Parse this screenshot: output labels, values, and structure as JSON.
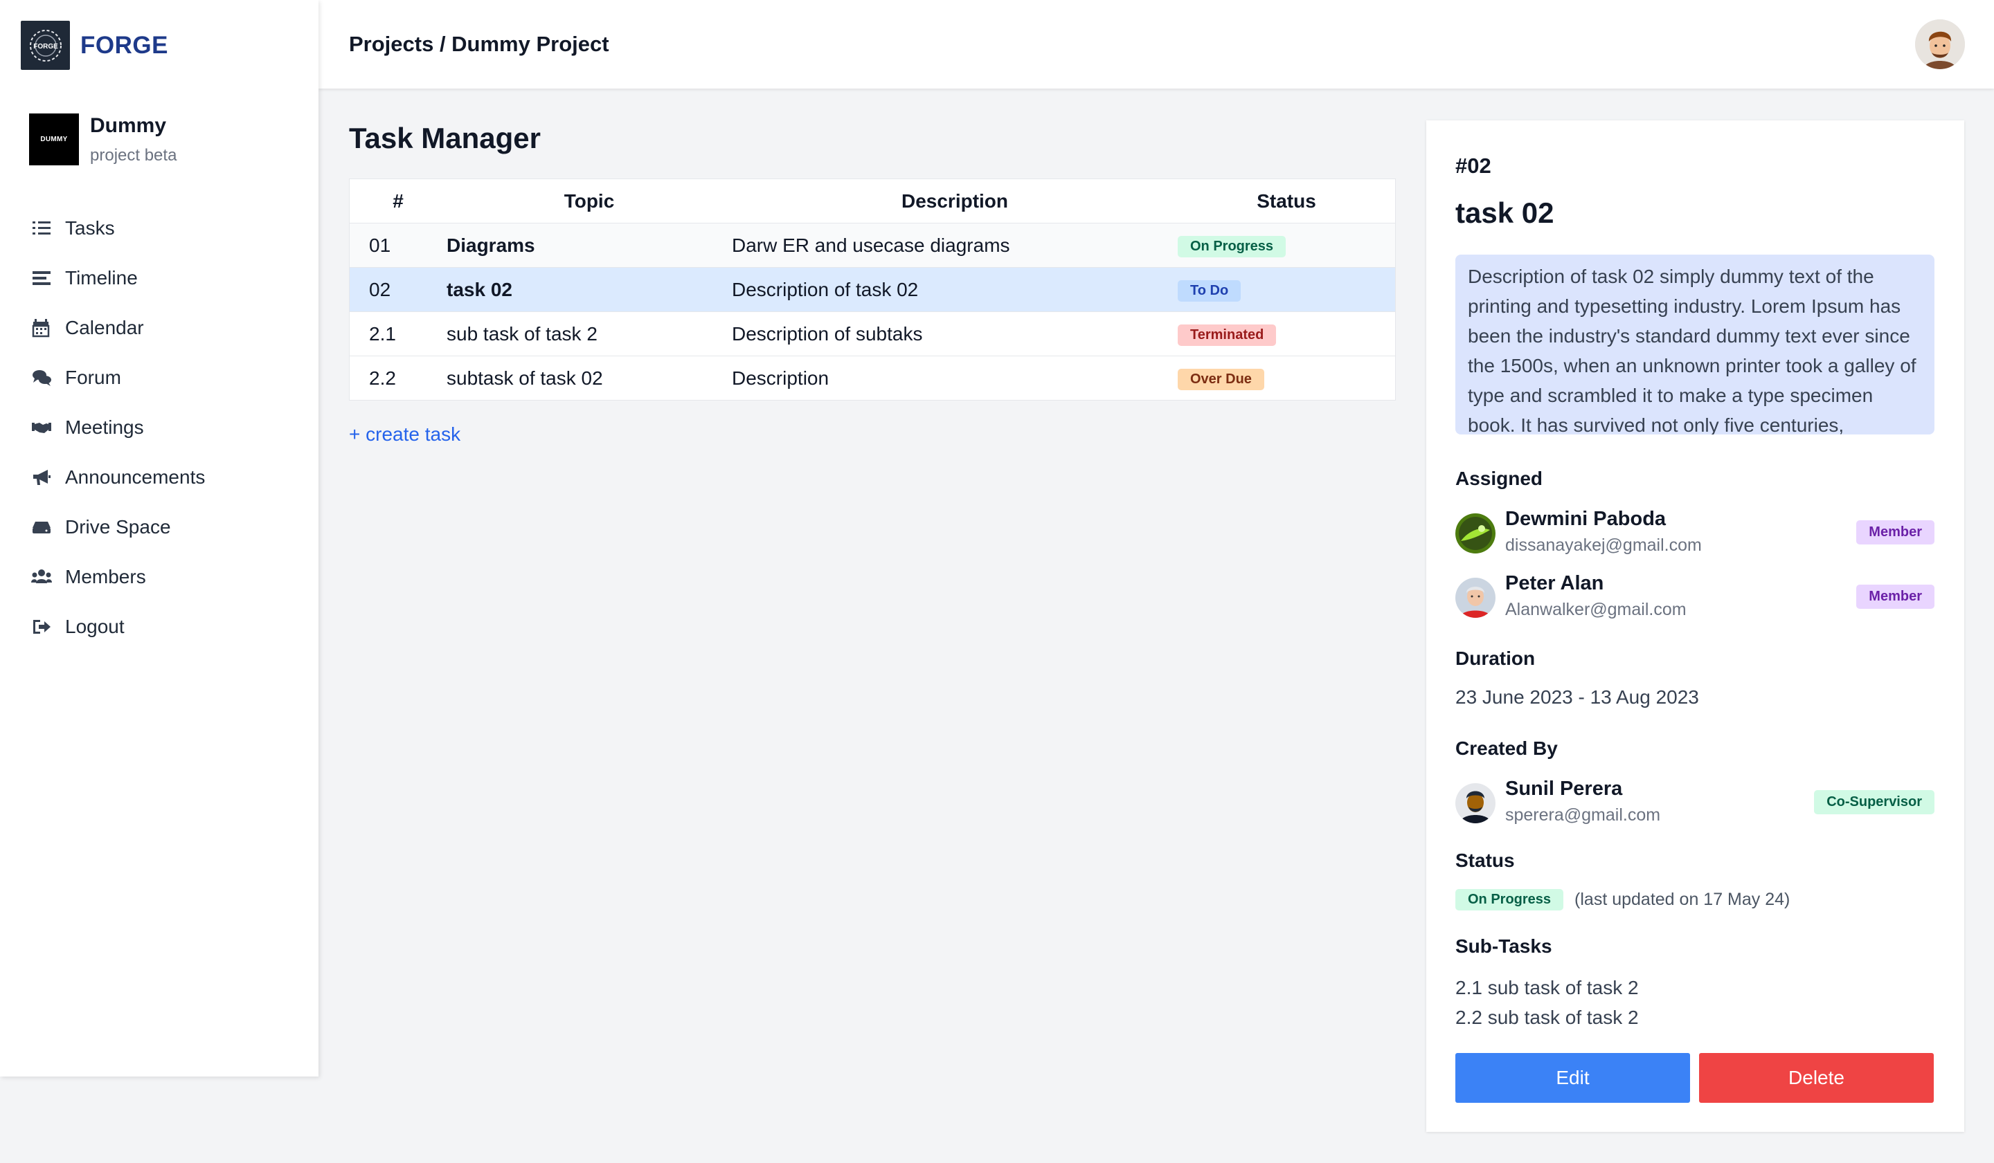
{
  "brand": {
    "name": "FORGE",
    "logo_text": "FORGE"
  },
  "project": {
    "logo_text": "DUMMY",
    "name": "Dummy",
    "subtitle": "project beta"
  },
  "sidebar": {
    "items": [
      {
        "label": "Tasks",
        "icon": "tasks-icon"
      },
      {
        "label": "Timeline",
        "icon": "timeline-icon"
      },
      {
        "label": "Calendar",
        "icon": "calendar-icon"
      },
      {
        "label": "Forum",
        "icon": "forum-icon"
      },
      {
        "label": "Meetings",
        "icon": "handshake-icon"
      },
      {
        "label": "Announcements",
        "icon": "megaphone-icon"
      },
      {
        "label": "Drive Space",
        "icon": "drive-icon"
      },
      {
        "label": "Members",
        "icon": "members-icon"
      },
      {
        "label": "Logout",
        "icon": "logout-icon"
      }
    ]
  },
  "header": {
    "breadcrumb": "Projects / Dummy Project"
  },
  "main": {
    "title": "Task Manager",
    "columns": [
      "#",
      "Topic",
      "Description",
      "Status"
    ],
    "rows": [
      {
        "id": "01",
        "topic": "Diagrams",
        "description": "Darw ER and usecase diagrams",
        "status": "On Progress"
      },
      {
        "id": "02",
        "topic": "task 02",
        "description": "Description of task 02",
        "status": "To Do"
      },
      {
        "id": "2.1",
        "topic": "sub task of task 2",
        "description": "Description of subtaks",
        "status": "Terminated"
      },
      {
        "id": "2.2",
        "topic": "subtask of task 02",
        "description": "Description",
        "status": "Over Due"
      }
    ],
    "create_label": "+ create task"
  },
  "detail": {
    "id": "#02",
    "title": "task 02",
    "description": "Description of task 02 simply dummy text of the printing and typesetting industry. Lorem Ipsum has been the industry's standard dummy text ever since the 1500s, when an unknown printer took a galley of type and scrambled it to make a type specimen book. It has survived not only five centuries,",
    "assigned_heading": "Assigned",
    "assigned": [
      {
        "name": "Dewmini Paboda",
        "email": "dissanayakej@gmail.com",
        "role": "Member"
      },
      {
        "name": "Peter Alan",
        "email": "Alanwalker@gmail.com",
        "role": "Member"
      }
    ],
    "duration_heading": "Duration",
    "duration": "23 June 2023 - 13 Aug 2023",
    "created_heading": "Created By",
    "creator": {
      "name": "Sunil Perera",
      "email": "sperera@gmail.com",
      "role": "Co-Supervisor"
    },
    "status_heading": "Status",
    "status": "On Progress",
    "status_note": "(last updated on 17 May 24)",
    "subtasks_heading": "Sub-Tasks",
    "subtasks": [
      "2.1 sub task of task 2",
      "2.2 sub task of task 2"
    ],
    "edit_label": "Edit",
    "delete_label": "Delete"
  },
  "colors": {
    "brand": "#1e3a8a",
    "link": "#2563eb",
    "selected_row": "#dbeafe",
    "edit": "#3b82f6",
    "delete": "#ef4444"
  }
}
